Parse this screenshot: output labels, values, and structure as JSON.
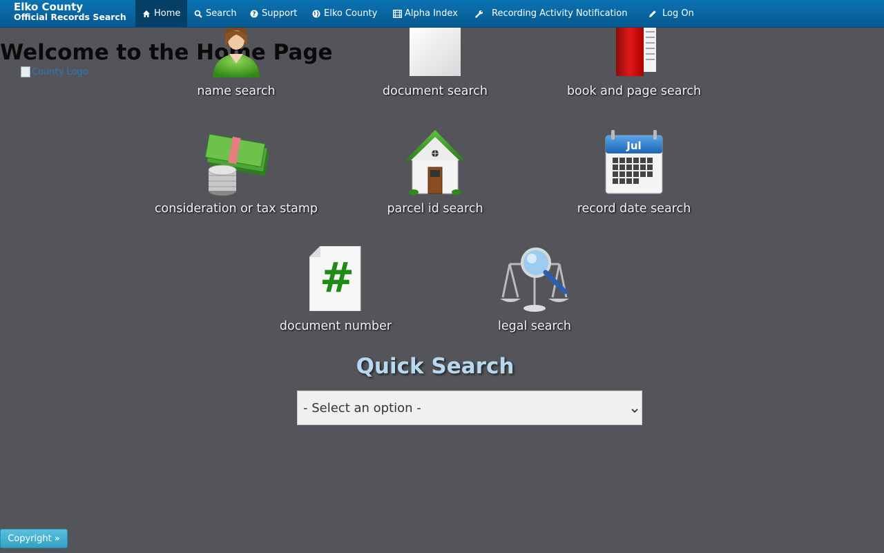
{
  "brand": {
    "line1": "Elko County",
    "line2": "Official Records Search"
  },
  "nav": {
    "home": "Home",
    "search": "Search",
    "support": "Support",
    "county": "Elko County",
    "alpha": "Alpha Index",
    "notification": "Recording Activity Notification",
    "logon": "Log On"
  },
  "welcome": {
    "title": "Welcome to the Home Page",
    "logo_alt": "County Logo"
  },
  "tiles": {
    "name": "name search",
    "document": "document search",
    "book": "book and page search",
    "consideration": "consideration or tax stamp",
    "parcel": "parcel id search",
    "record_date": "record date search",
    "doc_number": "document number",
    "legal": "legal search"
  },
  "calendar_month": "Jul",
  "quick_search": {
    "title": "Quick Search",
    "selected": "- Select an option -"
  },
  "footer": {
    "copyright": "Copyright »"
  },
  "colors": {
    "navbar": "#0b73b3",
    "background": "#54555a",
    "accent": "#b8d8f0"
  }
}
